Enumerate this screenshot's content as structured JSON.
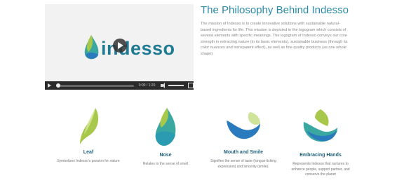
{
  "video": {
    "logo_text": "indesso",
    "time": "0:00 / 1:20"
  },
  "heading": {
    "title": "The Philosophy Behind Indesso",
    "description": "The mission of Indesso is to create innovative solutions with sustainable natural-based ingredients for life. This mission is depicted in the logogram which consists of several elements with specific meanings. The logogram of Indesso conveys our core strength in extracting nature (in its basic elements), sustainable business (through its color nuances and transparent effect), as well as fine quality products (as one whole shape)."
  },
  "features": [
    {
      "icon": "leaf-icon",
      "title": "Leaf",
      "description": "Symbolizes Indesso's passion for nature"
    },
    {
      "icon": "nose-icon",
      "title": "Nose",
      "description": "Relates to the sense of smell"
    },
    {
      "icon": "mouth-smile-icon",
      "title": "Mouth and Smile",
      "description": "Signifies the sense of taste (tongue-licking expression) and sincerity (smile)."
    },
    {
      "icon": "embracing-hands-icon",
      "title": "Embracing Hands",
      "description": "Represents Indesso that nurtures to enhance people, support partner, and conserve the planet"
    }
  ],
  "colors": {
    "accent": "#2a8aa8",
    "leaf_green": "#a7c84b",
    "teal": "#3aa8a0",
    "blue": "#2a7bbd"
  }
}
